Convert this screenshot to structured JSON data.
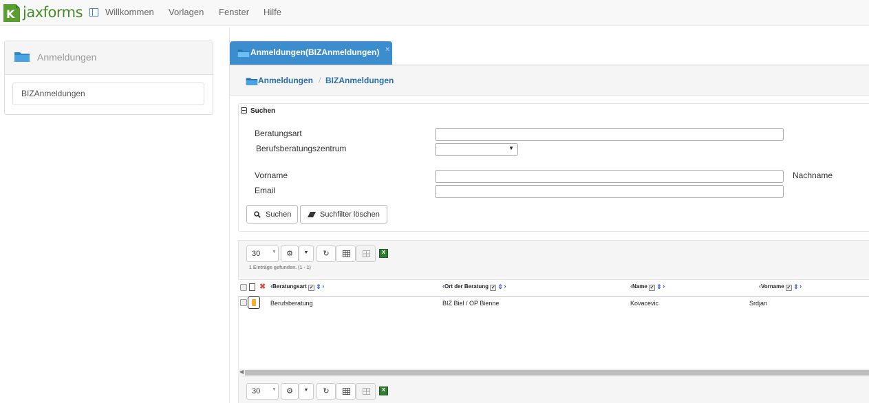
{
  "app": {
    "logo_text": "jaxforms"
  },
  "nav": {
    "items": [
      "Willkommen",
      "Vorlagen",
      "Fenster",
      "Hilfe"
    ]
  },
  "left": {
    "title": "Anmeldungen",
    "items": [
      "BIZAnmeldungen"
    ]
  },
  "tab": {
    "label": "Anmeldungen(BIZAnmeldungen)",
    "close": "×"
  },
  "breadcrumb": {
    "items": [
      "Anmeldungen",
      "BIZAnmeldungen"
    ],
    "separator": "/"
  },
  "search": {
    "legend": "Suchen",
    "fields": {
      "beratungsart": {
        "label": "Beratungsart",
        "value": ""
      },
      "zentrum": {
        "label": "Berufsberatungszentrum",
        "value": ""
      },
      "vorname": {
        "label": "Vorname",
        "value": ""
      },
      "nachname": {
        "label": "Nachname"
      },
      "email": {
        "label": "Email",
        "value": ""
      }
    },
    "search_button": "Suchen",
    "clear_button": "Suchfilter löschen"
  },
  "grid": {
    "page_size": "30",
    "count_text": "1 Einträge gefunden. (1 - 1)",
    "columns": [
      "Beratungsart",
      "Ort der Beratung",
      "Name",
      "Vorname"
    ],
    "rows": [
      {
        "beratungsart": "Berufsberatung",
        "ort": "BIZ Biel / OP Bienne",
        "name": "Kovacevic",
        "vorname": "Srdjan"
      }
    ]
  },
  "colors": {
    "accent": "#3c8dce",
    "link": "#2a6fa8",
    "logo_green": "#4a8a2a"
  },
  "icons": [
    "logo-icon",
    "dashboard-icon",
    "folder-icon",
    "search-icon",
    "eraser-icon",
    "gear-icon",
    "caret-down-icon",
    "refresh-icon",
    "columns-icon",
    "grid-icon",
    "excel-icon"
  ]
}
